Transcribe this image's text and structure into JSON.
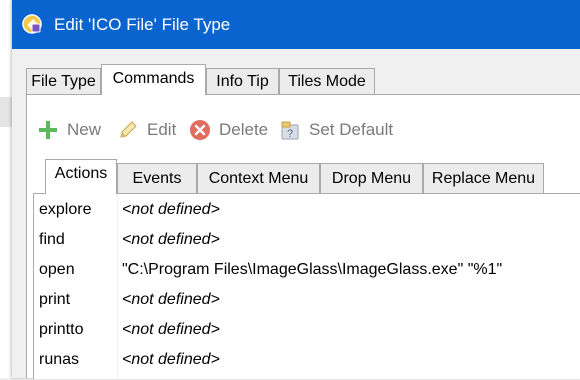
{
  "window": {
    "title": "Edit 'ICO File' File Type"
  },
  "main_tabs": [
    {
      "label": "File Type"
    },
    {
      "label": "Commands"
    },
    {
      "label": "Info Tip"
    },
    {
      "label": "Tiles Mode"
    }
  ],
  "active_main_tab": "Commands",
  "toolbar": {
    "new_label": "New",
    "edit_label": "Edit",
    "delete_label": "Delete",
    "set_default_label": "Set Default"
  },
  "sub_tabs": [
    {
      "label": "Actions"
    },
    {
      "label": "Events"
    },
    {
      "label": "Context Menu"
    },
    {
      "label": "Drop Menu"
    },
    {
      "label": "Replace Menu"
    }
  ],
  "active_sub_tab": "Actions",
  "actions": [
    {
      "name": "explore",
      "command": "<not defined>",
      "defined": false
    },
    {
      "name": "find",
      "command": "<not defined>",
      "defined": false
    },
    {
      "name": "open",
      "command": "\"C:\\Program Files\\ImageGlass\\ImageGlass.exe\" \"%1\"",
      "defined": true
    },
    {
      "name": "print",
      "command": "<not defined>",
      "defined": false
    },
    {
      "name": "printto",
      "command": "<not defined>",
      "defined": false
    },
    {
      "name": "runas",
      "command": "<not defined>",
      "defined": false
    }
  ],
  "colors": {
    "titlebar": "#0a64d0",
    "new_icon": "#5cb85c",
    "delete_icon": "#e06d5e"
  }
}
